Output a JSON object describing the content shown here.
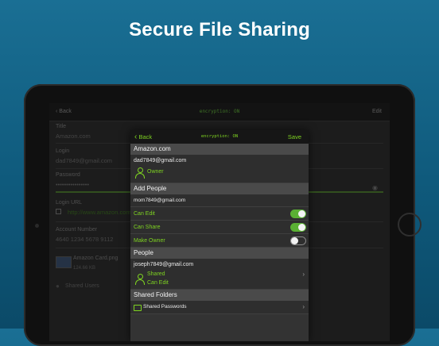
{
  "headline": "Secure File Sharing",
  "background_app": {
    "nav": {
      "back": "Back",
      "title": "encryption: ON",
      "edit": "Edit"
    },
    "fields": {
      "title_label": "Title",
      "title_value": "Amazon.com",
      "login_label": "Login",
      "login_value": "dad7849@gmail.com",
      "password_label": "Password",
      "password_value": "••••••••••••••••",
      "url_label": "Login URL",
      "url_value": "http://www.amazon.com",
      "account_label": "Account Number",
      "account_value": "4640 1234 5678 9112",
      "attachment_name": "Amazon Card.png",
      "attachment_size": "124.66 KB",
      "shared_users": "Shared Users"
    }
  },
  "modal": {
    "nav": {
      "back": "Back",
      "title": "encryption: ON",
      "save": "Save"
    },
    "item_section": "Amazon.com",
    "owner_email": "dad7849@gmail.com",
    "owner_role": "Owner",
    "add_people_section": "Add People",
    "add_email": "mom7849@gmail.com",
    "permissions": [
      {
        "label": "Can Edit",
        "on": true
      },
      {
        "label": "Can Share",
        "on": true
      },
      {
        "label": "Make Owner",
        "on": false
      }
    ],
    "people_section": "People",
    "person_email": "joseph7849@gmail.com",
    "person_status": "Shared",
    "person_perm": "Can Edit",
    "shared_folders_section": "Shared Folders",
    "shared_folder": "Shared Passwords"
  },
  "colors": {
    "accent": "#7ed321",
    "background": "#1a6f94"
  },
  "icons": [
    "back-chevron-icon",
    "person-icon",
    "chevron-right-icon",
    "folder-icon",
    "eye-icon",
    "image-thumbnail"
  ]
}
